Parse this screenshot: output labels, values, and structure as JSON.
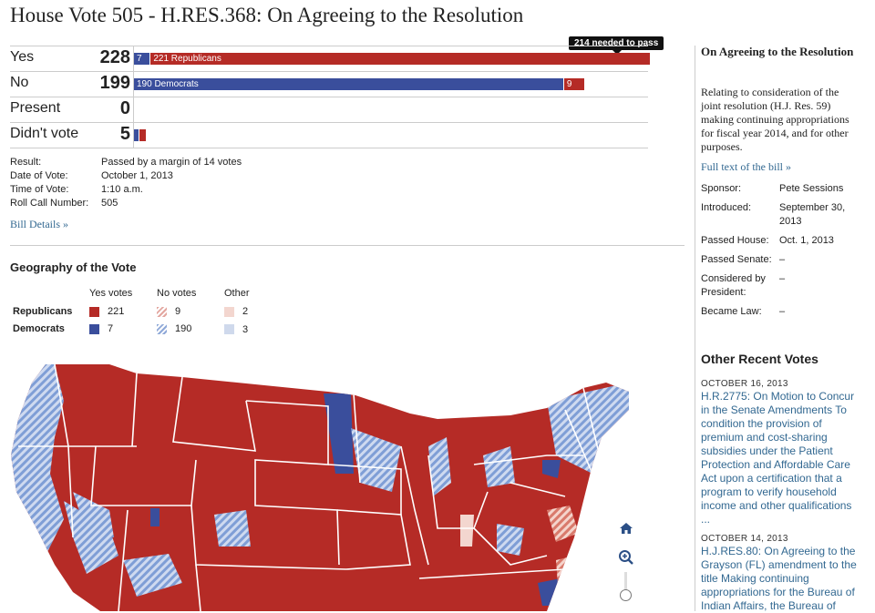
{
  "page": {
    "title": "House Vote 505 - H.RES.368: On Agreeing to the Resolution"
  },
  "votes": {
    "pass_tooltip": "214 needed to pass",
    "rows": [
      {
        "label": "Yes",
        "count": "228",
        "segments": [
          {
            "text": "7",
            "color": "#3a4e9c",
            "share": 7
          },
          {
            "text": "221 Republicans",
            "color": "#b52b26",
            "share": 221
          }
        ]
      },
      {
        "label": "No",
        "count": "199",
        "segments": [
          {
            "text": "190 Democrats",
            "color": "#3a4e9c",
            "share": 190
          },
          {
            "text": "9",
            "color": "#b52b26",
            "share": 9
          }
        ]
      },
      {
        "label": "Present",
        "count": "0",
        "segments": []
      },
      {
        "label": "Didn't vote",
        "count": "5",
        "segments": [
          {
            "text": "",
            "color": "#3a4e9c",
            "share": 2
          },
          {
            "text": "",
            "color": "#b52b26",
            "share": 3
          }
        ]
      }
    ],
    "total_seats": 228
  },
  "details": {
    "result_label": "Result:",
    "result": "Passed by a margin of 14 votes",
    "date_label": "Date of Vote:",
    "date": "October 1, 2013",
    "time_label": "Time of Vote:",
    "time": "1:10 a.m.",
    "roll_label": "Roll Call Number:",
    "roll": "505",
    "bill_details_link": "Bill Details »"
  },
  "geography": {
    "title": "Geography of the Vote",
    "headers": {
      "yes": "Yes votes",
      "no": "No votes",
      "other": "Other"
    },
    "republicans": {
      "label": "Republicans",
      "yes": "221",
      "no": "9",
      "other": "2"
    },
    "democrats": {
      "label": "Democrats",
      "yes": "7",
      "no": "190",
      "other": "3"
    }
  },
  "map_controls": {
    "home": "home-icon",
    "zoom_in": "zoom-in-icon"
  },
  "sidebar": {
    "title": "On Agreeing to the Resolution",
    "description": "Relating to consideration of the joint resolution (H.J. Res. 59) making continuing appropriations for fiscal year 2014, and for other purposes.",
    "full_text_link": "Full text of the bill »",
    "facts": [
      {
        "k": "Sponsor:",
        "v": "Pete Sessions"
      },
      {
        "k": "Introduced:",
        "v": "September 30, 2013"
      },
      {
        "k": "Passed House:",
        "v": "Oct. 1, 2013"
      },
      {
        "k": "Passed Senate:",
        "v": "–"
      },
      {
        "k": "Considered by President:",
        "v": "–"
      },
      {
        "k": "Became Law:",
        "v": "–"
      }
    ],
    "recent_title": "Other Recent Votes",
    "recent": [
      {
        "date": "OCTOBER 16, 2013",
        "text": "H.R.2775: On Motion to Concur in the Senate Amendments To condition the provision of premium and cost-sharing subsidies under the Patient Protection and Affordable Care Act upon a certification that a program to verify household income and other qualifications ..."
      },
      {
        "date": "OCTOBER 14, 2013",
        "text": "H.J.RES.80: On Agreeing to the Grayson (FL) amendment to the title Making continuing appropriations for the Bureau of Indian Affairs, the Bureau of"
      }
    ]
  }
}
